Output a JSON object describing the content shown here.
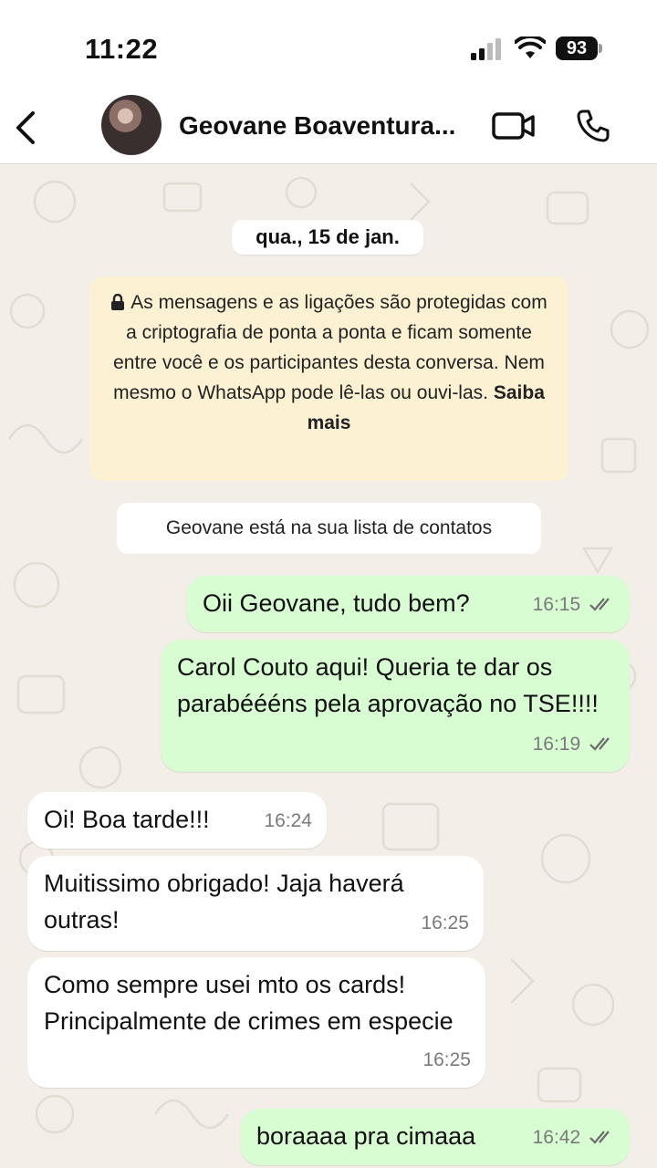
{
  "status": {
    "time": "11:22",
    "battery": "93"
  },
  "header": {
    "contact_name": "Geovane Boaventura..."
  },
  "chat": {
    "date_chip": "qua., 15 de jan.",
    "encryption_text": "As mensagens e as ligações são protegidas com a criptografia de ponta a ponta e ficam somente entre você e os participantes desta conversa. Nem mesmo o WhatsApp pode lê-las ou ouvi-las.",
    "encryption_link": "Saiba mais",
    "contact_notice": "Geovane está na sua lista de contatos",
    "messages": [
      {
        "direction": "out",
        "text": "Oii Geovane, tudo bem?",
        "time": "16:15",
        "status": "read"
      },
      {
        "direction": "out",
        "text": "Carol Couto aqui! Queria te dar os parabéééns pela aprovação no TSE!!!!",
        "time": "16:19",
        "status": "read"
      },
      {
        "direction": "in",
        "text": "Oi! Boa tarde!!!",
        "time": "16:24"
      },
      {
        "direction": "in",
        "text": "Muitissimo obrigado! Jaja haverá outras!",
        "time": "16:25"
      },
      {
        "direction": "in",
        "text": "Como sempre usei mto os cards! Principalmente de crimes em especie",
        "time": "16:25"
      },
      {
        "direction": "out",
        "text": "boraaaa pra cimaaa",
        "time": "16:42",
        "status": "read"
      }
    ]
  },
  "colors": {
    "outgoing_bubble": "#d9fdd3",
    "incoming_bubble": "#ffffff",
    "notice_bg": "#fdf1d3",
    "read_ticks": "#6b6b6b"
  },
  "icons": [
    "signal-icon",
    "wifi-icon",
    "back-arrow-icon",
    "video-call-icon",
    "phone-icon",
    "lock-icon",
    "double-check-icon"
  ]
}
